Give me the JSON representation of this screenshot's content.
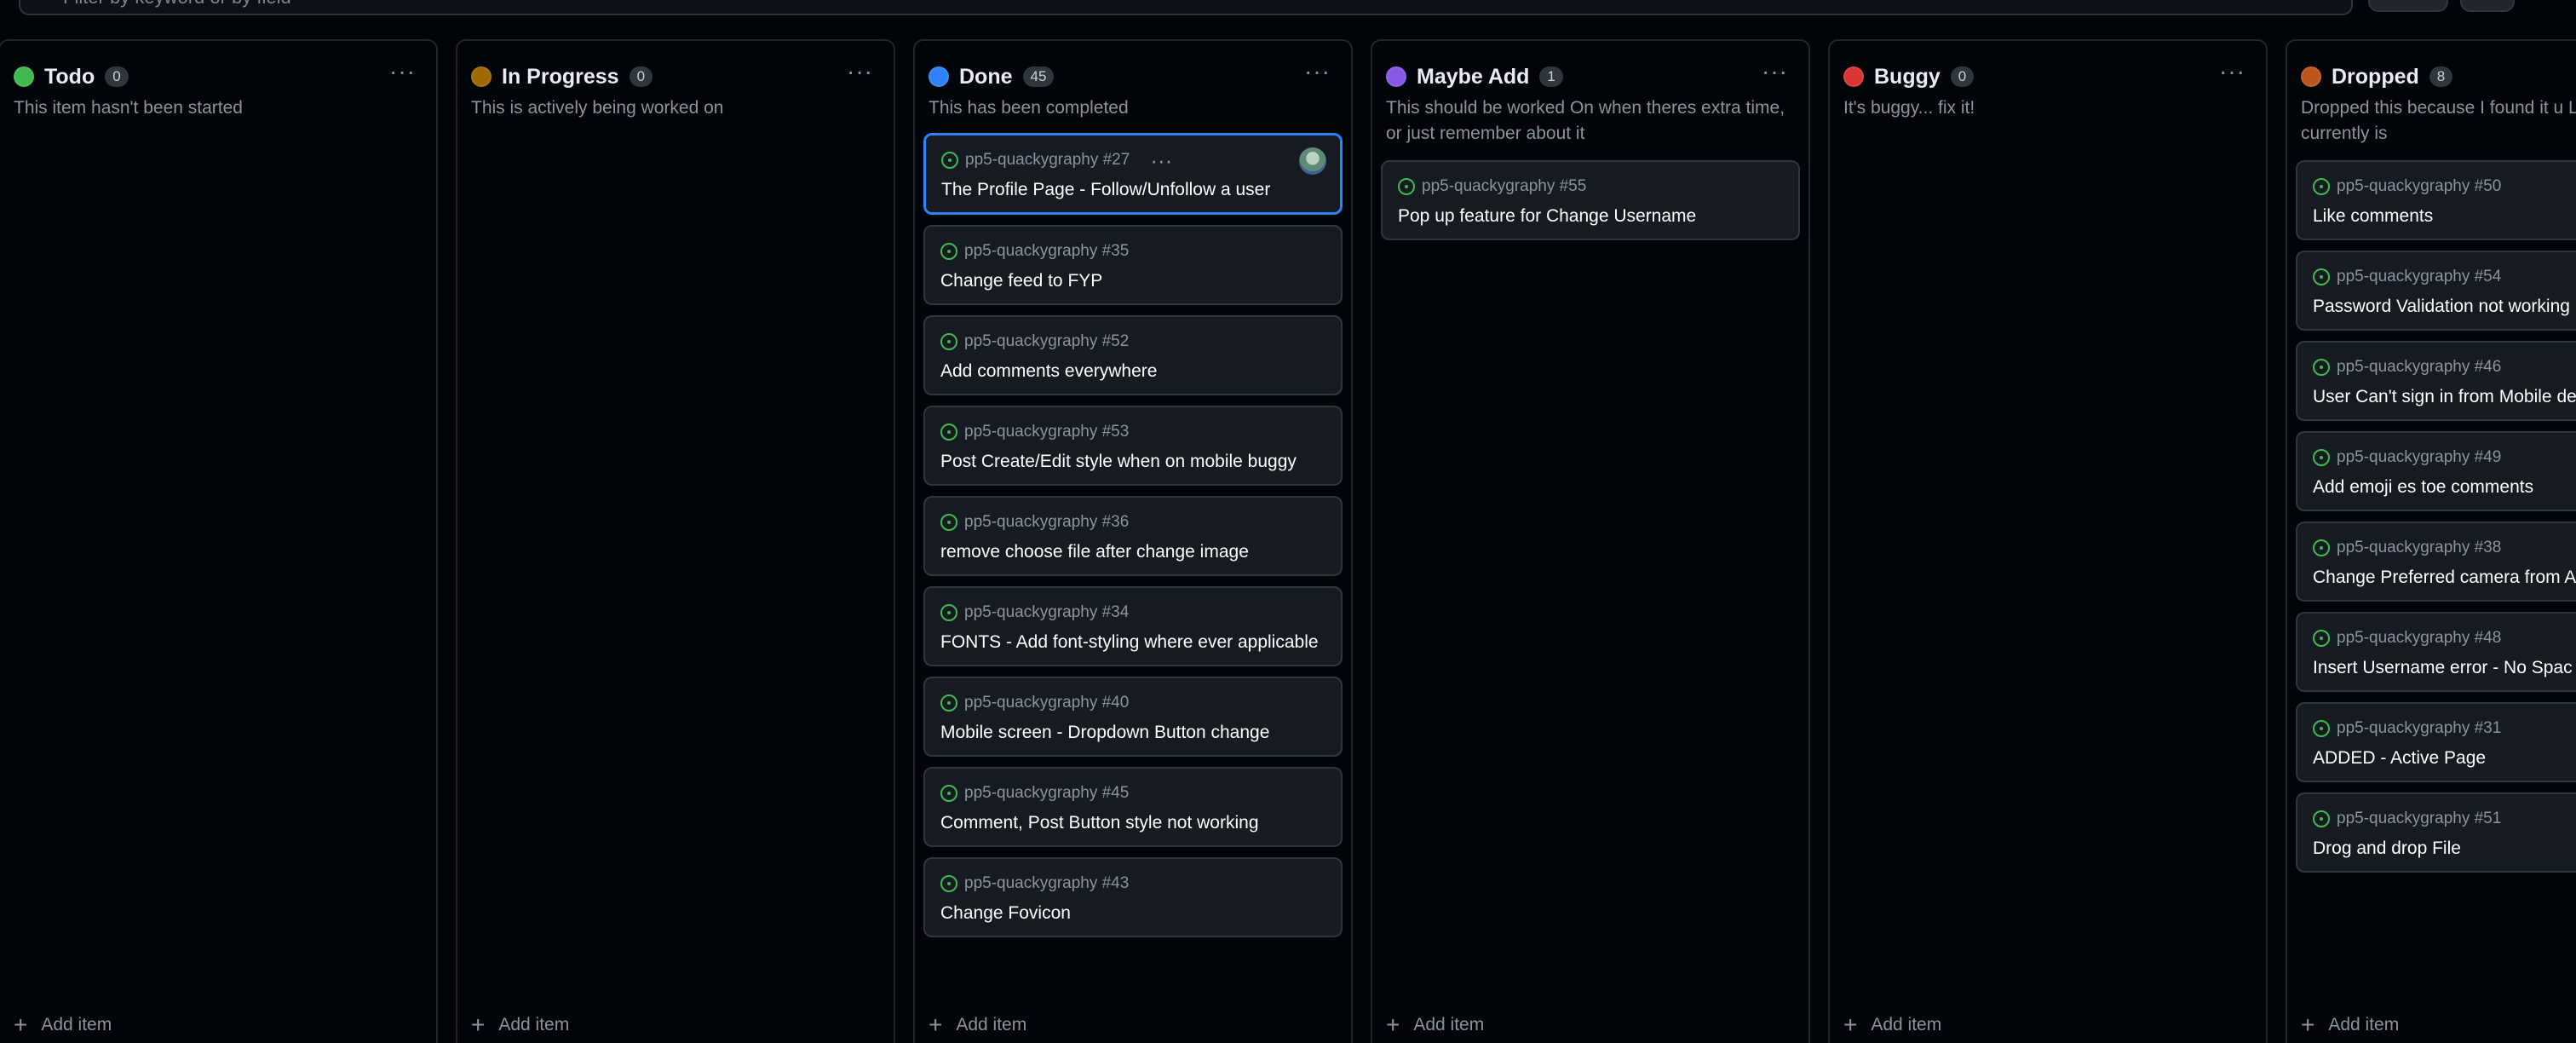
{
  "filter": {
    "placeholder": "Filter by keyword or by field"
  },
  "columns": [
    {
      "title": "Todo",
      "count": "0",
      "color": "#3fb950",
      "description": "This item hasn't been started",
      "add_label": "Add item",
      "cards": []
    },
    {
      "title": "In Progress",
      "count": "0",
      "color": "#9e6a03",
      "description": "This is actively being worked on",
      "add_label": "Add item",
      "cards": []
    },
    {
      "title": "Done",
      "count": "45",
      "color": "#2f81f7",
      "description": "This has been completed",
      "add_label": "Add item",
      "cards": [
        {
          "ref": "pp5-quackygraphy #27",
          "title": "The Profile Page - Follow/Unfollow a user",
          "selected": true
        },
        {
          "ref": "pp5-quackygraphy #35",
          "title": "Change feed to FYP"
        },
        {
          "ref": "pp5-quackygraphy #52",
          "title": "Add comments everywhere"
        },
        {
          "ref": "pp5-quackygraphy #53",
          "title": "Post Create/Edit style when on mobile buggy"
        },
        {
          "ref": "pp5-quackygraphy #36",
          "title": "remove choose file after change image"
        },
        {
          "ref": "pp5-quackygraphy #34",
          "title": "FONTS - Add font-styling where ever applicable"
        },
        {
          "ref": "pp5-quackygraphy #40",
          "title": "Mobile screen - Dropdown Button change"
        },
        {
          "ref": "pp5-quackygraphy #45",
          "title": "Comment, Post Button style not working"
        },
        {
          "ref": "pp5-quackygraphy #43",
          "title": "Change Fovicon"
        }
      ]
    },
    {
      "title": "Maybe Add",
      "count": "1",
      "color": "#8957e5",
      "description": "This should be worked On when theres extra time, or just remember about it",
      "add_label": "Add item",
      "cards": [
        {
          "ref": "pp5-quackygraphy #55",
          "title": "Pop up feature for Change Username"
        }
      ]
    },
    {
      "title": "Buggy",
      "count": "0",
      "color": "#da3633",
      "description": "It's buggy... fix it!",
      "add_label": "Add item",
      "cards": []
    },
    {
      "title": "Dropped",
      "count": "8",
      "color": "#bd561d",
      "description": "Dropped this because I found it u Liked how it currently is",
      "add_label": "Add item",
      "cards": [
        {
          "ref": "pp5-quackygraphy #50",
          "title": "Like comments"
        },
        {
          "ref": "pp5-quackygraphy #54",
          "title": "Password Validation not working Register Page"
        },
        {
          "ref": "pp5-quackygraphy #46",
          "title": "User Can't sign in from Mobile de"
        },
        {
          "ref": "pp5-quackygraphy #49",
          "title": "Add emoji es toe comments"
        },
        {
          "ref": "pp5-quackygraphy #38",
          "title": "Change Preferred camera from A Undecided"
        },
        {
          "ref": "pp5-quackygraphy #48",
          "title": "Insert Username error - No Spac"
        },
        {
          "ref": "pp5-quackygraphy #31",
          "title": "ADDED - Active Page"
        },
        {
          "ref": "pp5-quackygraphy #51",
          "title": "Drog and drop File"
        }
      ]
    }
  ]
}
